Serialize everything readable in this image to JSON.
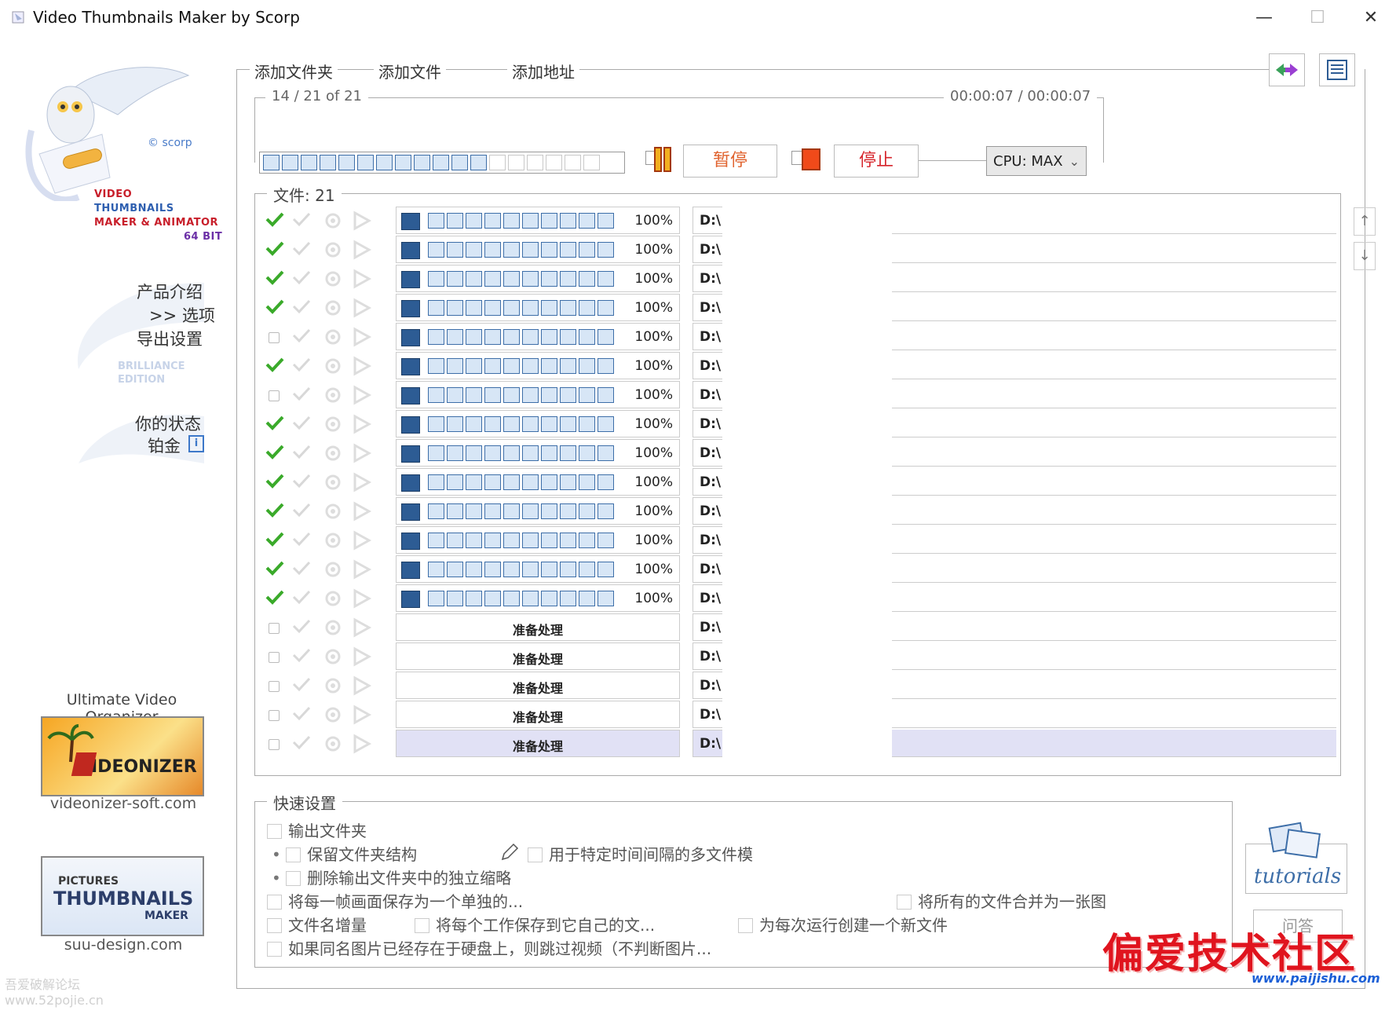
{
  "window": {
    "title": "Video Thumbnails Maker by Scorp",
    "minimize": "—",
    "maximize": "☐",
    "close": "✕"
  },
  "logo": {
    "copyright": "© scorp",
    "line1": "VIDEO",
    "line2": "THUMBNAILS",
    "line3": "MAKER & ANIMATOR",
    "line4": "64 BIT"
  },
  "nav": {
    "intro": "产品介绍",
    "options": ">> 选项",
    "export": "导出设置",
    "edition_line1": "BRILLIANCE",
    "edition_line2": "EDITION",
    "status": "你的状态",
    "level": "铂金"
  },
  "promos": [
    {
      "title": "Ultimate Video Organizer",
      "image_text": "IDEONIZER",
      "link": "videonizer-soft.com"
    },
    {
      "title": "",
      "image_text_small": "PICTURES",
      "image_text_big": "THUMBNAILS",
      "image_text_maker": "MAKER",
      "link": "suu-design.com"
    }
  ],
  "tabs": [
    "添加文件夹",
    "添加文件",
    "添加地址"
  ],
  "progress": {
    "count": "14 / 21  of  21",
    "time": "00:00:07  /  00:00:07",
    "filled_cells": 12,
    "total_cells": 18,
    "pause_label": "暂停",
    "stop_label": "停止",
    "cpu_label": "CPU: MAX"
  },
  "files": {
    "label": "文件: 21",
    "rows": [
      {
        "done": true,
        "pct": "100%",
        "drive": "D:\\"
      },
      {
        "done": true,
        "pct": "100%",
        "drive": "D:\\"
      },
      {
        "done": true,
        "pct": "100%",
        "drive": "D:\\"
      },
      {
        "done": true,
        "pct": "100%",
        "drive": "D:\\"
      },
      {
        "done": false,
        "pct": "100%",
        "drive": "D:\\"
      },
      {
        "done": true,
        "pct": "100%",
        "drive": "D:\\"
      },
      {
        "done": false,
        "pct": "100%",
        "drive": "D:\\"
      },
      {
        "done": true,
        "pct": "100%",
        "drive": "D:\\"
      },
      {
        "done": true,
        "pct": "100%",
        "drive": "D:\\"
      },
      {
        "done": true,
        "pct": "100%",
        "drive": "D:\\"
      },
      {
        "done": true,
        "pct": "100%",
        "drive": "D:\\"
      },
      {
        "done": true,
        "pct": "100%",
        "drive": "D:\\"
      },
      {
        "done": true,
        "pct": "100%",
        "drive": "D:\\"
      },
      {
        "done": true,
        "pct": "100%",
        "drive": "D:\\"
      },
      {
        "done": false,
        "status": "准备处理",
        "drive": "D:\\"
      },
      {
        "done": false,
        "status": "准备处理",
        "drive": "D:\\"
      },
      {
        "done": false,
        "status": "准备处理",
        "drive": "D:\\"
      },
      {
        "done": false,
        "status": "准备处理",
        "drive": "D:\\"
      },
      {
        "done": false,
        "status": "准备处理",
        "drive": "D:\\",
        "selected": true
      }
    ]
  },
  "quick": {
    "label": "快速设置",
    "output_folder": "输出文件夹",
    "keep_structure": "保留文件夹结构",
    "multi_file_mode": "用于特定时间间隔的多文件模",
    "delete_thumbs": "删除输出文件夹中的独立缩略",
    "save_each_frame": "将每一帧画面保存为一个单独的...",
    "merge_all": "将所有的文件合并为一张图",
    "filename_increment": "文件名增量",
    "save_each_job": "将每个工作保存到它自己的文...",
    "new_file_each_run": "为每次运行创建一个新文件",
    "skip_existing": "如果同名图片已经存在于硬盘上，则跳过视频（不判断图片..."
  },
  "side_buttons": {
    "tutorials": "tutorials",
    "qa": "问答",
    "up": "↑",
    "down": "↓"
  },
  "watermarks": {
    "left_line1": "吾爱破解论坛",
    "left_line2": "www.52pojie.cn",
    "right_title": "偏爱技术社区",
    "right_url": "www.paijishu.com"
  },
  "colors": {
    "accent_orange": "#e0622d",
    "progress_blue": "#3d6ea8",
    "check_green": "#3aaa2a",
    "selected_row": "#e1e1f5"
  }
}
